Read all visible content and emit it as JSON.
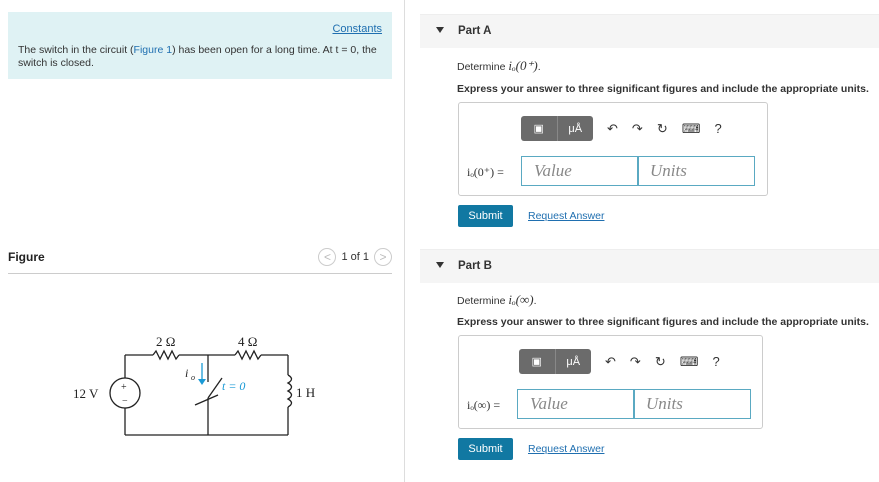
{
  "problem": {
    "constants_link": "Constants",
    "text_before": "The switch in the circuit (",
    "figure_link": "Figure 1",
    "text_after": ") has been open for a long time. At t = 0, the switch is closed."
  },
  "figure": {
    "label": "Figure",
    "pager_text": "1 of 1",
    "prev_symbol": "<",
    "next_symbol": ">",
    "circuit": {
      "r1": "2 Ω",
      "r2": "4 Ω",
      "source": "12 V",
      "inductor": "1 H",
      "current": "i",
      "current_sub": "o",
      "switch": "t = 0",
      "plus": "+",
      "minus": "−"
    }
  },
  "parts": [
    {
      "title": "Part A",
      "determine_prefix": "Determine ",
      "determine_expr": "iₒ(0⁺)",
      "determine_suffix": ".",
      "instruction": "Express your answer to three significant figures and include the appropriate units.",
      "eq_label": "iₒ(0⁺) =",
      "value_placeholder": "Value",
      "units_placeholder": "Units",
      "submit_label": "Submit",
      "request_label": "Request Answer"
    },
    {
      "title": "Part B",
      "determine_prefix": "Determine ",
      "determine_expr": "iₒ(∞)",
      "determine_suffix": ".",
      "instruction": "Express your answer to three significant figures and include the appropriate units.",
      "eq_label": "iₒ(∞) =",
      "value_placeholder": "Value",
      "units_placeholder": "Units",
      "submit_label": "Submit",
      "request_label": "Request Answer"
    }
  ],
  "toolbar": {
    "template_glyph": "▣",
    "units_glyph": "μÅ",
    "undo_glyph": "↶",
    "redo_glyph": "↷",
    "reset_glyph": "↻",
    "keyboard_glyph": "⌨",
    "help_glyph": "?"
  },
  "colors": {
    "accent": "#1178a2",
    "problem_bg": "#dff2f4",
    "link": "#1f6fb0"
  }
}
